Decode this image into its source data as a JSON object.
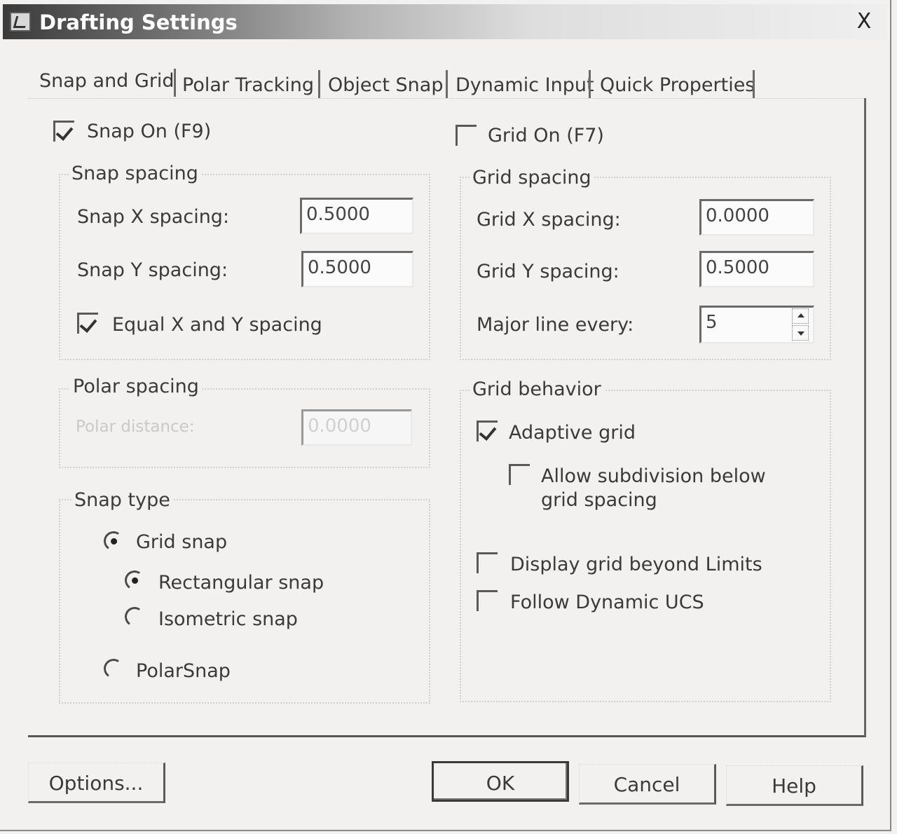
{
  "window": {
    "title": "Drafting Settings",
    "close_label": "X"
  },
  "tabs": [
    {
      "label": "Snap and Grid",
      "active": true
    },
    {
      "label": "Polar Tracking",
      "active": false
    },
    {
      "label": "Object Snap",
      "active": false
    },
    {
      "label": "Dynamic Input",
      "active": false
    },
    {
      "label": "Quick Properties",
      "active": false
    }
  ],
  "snap": {
    "on_label": "Snap On (F9)",
    "on_checked": true,
    "spacing_title": "Snap spacing",
    "x_label": "Snap X spacing:",
    "x_value": "0.5000",
    "y_label": "Snap Y spacing:",
    "y_value": "0.5000",
    "equal_label": "Equal X and Y spacing",
    "equal_checked": true
  },
  "polar": {
    "title": "Polar spacing",
    "distance_label": "Polar distance:",
    "distance_value": "0.0000"
  },
  "snap_type": {
    "title": "Snap type",
    "grid_snap": "Grid snap",
    "rectangular": "Rectangular snap",
    "isometric": "Isometric snap",
    "polarsnap": "PolarSnap",
    "selected": "Rectangular snap"
  },
  "grid": {
    "on_label": "Grid On (F7)",
    "on_checked": false,
    "spacing_title": "Grid spacing",
    "x_label": "Grid X spacing:",
    "x_value": "0.0000",
    "y_label": "Grid Y spacing:",
    "y_value": "0.5000",
    "major_label": "Major line every:",
    "major_value": "5"
  },
  "grid_behavior": {
    "title": "Grid behavior",
    "adaptive": "Adaptive grid",
    "adaptive_checked": true,
    "subdivision_line1": "Allow subdivision below",
    "subdivision_line2": "grid spacing",
    "subdivision_checked": false,
    "beyond_limits": "Display grid beyond Limits",
    "beyond_checked": false,
    "follow_ucs": "Follow Dynamic UCS",
    "follow_checked": false
  },
  "buttons": {
    "options": "Options...",
    "ok": "OK",
    "cancel": "Cancel",
    "help": "Help"
  }
}
